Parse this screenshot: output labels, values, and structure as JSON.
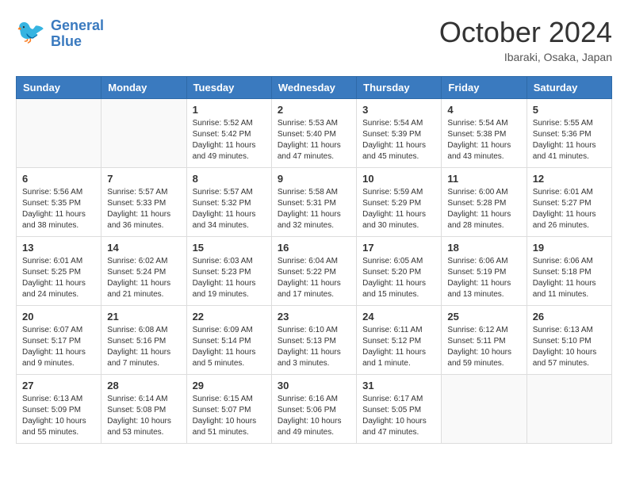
{
  "logo": {
    "line1": "General",
    "line2": "Blue"
  },
  "title": "October 2024",
  "location": "Ibaraki, Osaka, Japan",
  "weekdays": [
    "Sunday",
    "Monday",
    "Tuesday",
    "Wednesday",
    "Thursday",
    "Friday",
    "Saturday"
  ],
  "days": [
    {
      "date": "",
      "info": ""
    },
    {
      "date": "",
      "info": ""
    },
    {
      "date": "1",
      "sunrise": "5:52 AM",
      "sunset": "5:42 PM",
      "daylight": "11 hours and 49 minutes."
    },
    {
      "date": "2",
      "sunrise": "5:53 AM",
      "sunset": "5:40 PM",
      "daylight": "11 hours and 47 minutes."
    },
    {
      "date": "3",
      "sunrise": "5:54 AM",
      "sunset": "5:39 PM",
      "daylight": "11 hours and 45 minutes."
    },
    {
      "date": "4",
      "sunrise": "5:54 AM",
      "sunset": "5:38 PM",
      "daylight": "11 hours and 43 minutes."
    },
    {
      "date": "5",
      "sunrise": "5:55 AM",
      "sunset": "5:36 PM",
      "daylight": "11 hours and 41 minutes."
    },
    {
      "date": "6",
      "sunrise": "5:56 AM",
      "sunset": "5:35 PM",
      "daylight": "11 hours and 38 minutes."
    },
    {
      "date": "7",
      "sunrise": "5:57 AM",
      "sunset": "5:33 PM",
      "daylight": "11 hours and 36 minutes."
    },
    {
      "date": "8",
      "sunrise": "5:57 AM",
      "sunset": "5:32 PM",
      "daylight": "11 hours and 34 minutes."
    },
    {
      "date": "9",
      "sunrise": "5:58 AM",
      "sunset": "5:31 PM",
      "daylight": "11 hours and 32 minutes."
    },
    {
      "date": "10",
      "sunrise": "5:59 AM",
      "sunset": "5:29 PM",
      "daylight": "11 hours and 30 minutes."
    },
    {
      "date": "11",
      "sunrise": "6:00 AM",
      "sunset": "5:28 PM",
      "daylight": "11 hours and 28 minutes."
    },
    {
      "date": "12",
      "sunrise": "6:01 AM",
      "sunset": "5:27 PM",
      "daylight": "11 hours and 26 minutes."
    },
    {
      "date": "13",
      "sunrise": "6:01 AM",
      "sunset": "5:25 PM",
      "daylight": "11 hours and 24 minutes."
    },
    {
      "date": "14",
      "sunrise": "6:02 AM",
      "sunset": "5:24 PM",
      "daylight": "11 hours and 21 minutes."
    },
    {
      "date": "15",
      "sunrise": "6:03 AM",
      "sunset": "5:23 PM",
      "daylight": "11 hours and 19 minutes."
    },
    {
      "date": "16",
      "sunrise": "6:04 AM",
      "sunset": "5:22 PM",
      "daylight": "11 hours and 17 minutes."
    },
    {
      "date": "17",
      "sunrise": "6:05 AM",
      "sunset": "5:20 PM",
      "daylight": "11 hours and 15 minutes."
    },
    {
      "date": "18",
      "sunrise": "6:06 AM",
      "sunset": "5:19 PM",
      "daylight": "11 hours and 13 minutes."
    },
    {
      "date": "19",
      "sunrise": "6:06 AM",
      "sunset": "5:18 PM",
      "daylight": "11 hours and 11 minutes."
    },
    {
      "date": "20",
      "sunrise": "6:07 AM",
      "sunset": "5:17 PM",
      "daylight": "11 hours and 9 minutes."
    },
    {
      "date": "21",
      "sunrise": "6:08 AM",
      "sunset": "5:16 PM",
      "daylight": "11 hours and 7 minutes."
    },
    {
      "date": "22",
      "sunrise": "6:09 AM",
      "sunset": "5:14 PM",
      "daylight": "11 hours and 5 minutes."
    },
    {
      "date": "23",
      "sunrise": "6:10 AM",
      "sunset": "5:13 PM",
      "daylight": "11 hours and 3 minutes."
    },
    {
      "date": "24",
      "sunrise": "6:11 AM",
      "sunset": "5:12 PM",
      "daylight": "11 hours and 1 minute."
    },
    {
      "date": "25",
      "sunrise": "6:12 AM",
      "sunset": "5:11 PM",
      "daylight": "10 hours and 59 minutes."
    },
    {
      "date": "26",
      "sunrise": "6:13 AM",
      "sunset": "5:10 PM",
      "daylight": "10 hours and 57 minutes."
    },
    {
      "date": "27",
      "sunrise": "6:13 AM",
      "sunset": "5:09 PM",
      "daylight": "10 hours and 55 minutes."
    },
    {
      "date": "28",
      "sunrise": "6:14 AM",
      "sunset": "5:08 PM",
      "daylight": "10 hours and 53 minutes."
    },
    {
      "date": "29",
      "sunrise": "6:15 AM",
      "sunset": "5:07 PM",
      "daylight": "10 hours and 51 minutes."
    },
    {
      "date": "30",
      "sunrise": "6:16 AM",
      "sunset": "5:06 PM",
      "daylight": "10 hours and 49 minutes."
    },
    {
      "date": "31",
      "sunrise": "6:17 AM",
      "sunset": "5:05 PM",
      "daylight": "10 hours and 47 minutes."
    },
    {
      "date": "",
      "info": ""
    },
    {
      "date": "",
      "info": ""
    },
    {
      "date": "",
      "info": ""
    },
    {
      "date": "",
      "info": ""
    }
  ],
  "labels": {
    "sunrise": "Sunrise:",
    "sunset": "Sunset:",
    "daylight": "Daylight:"
  }
}
